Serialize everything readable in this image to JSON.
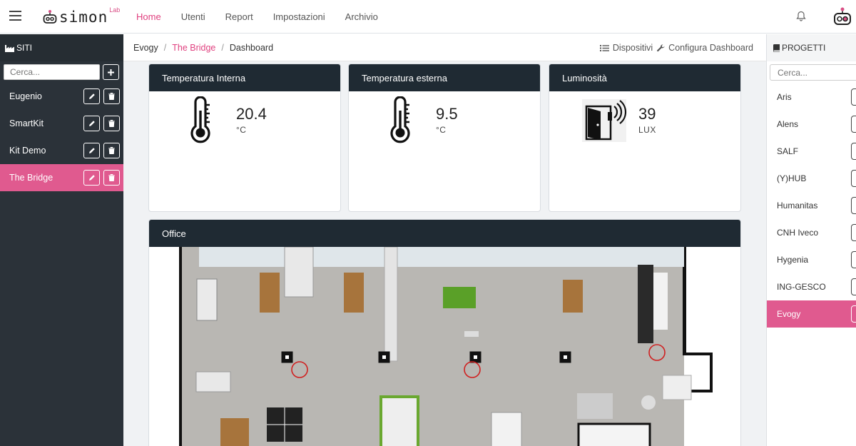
{
  "topbar": {
    "logo_text": "simon",
    "logo_sup": "Lab",
    "nav": [
      {
        "label": "Home",
        "active": true
      },
      {
        "label": "Utenti",
        "active": false
      },
      {
        "label": "Report",
        "active": false
      },
      {
        "label": "Impostazioni",
        "active": false
      },
      {
        "label": "Archivio",
        "active": false
      }
    ]
  },
  "sidebar": {
    "title": "SITI",
    "search_placeholder": "Cerca...",
    "sites": [
      {
        "label": "Eugenio",
        "active": false
      },
      {
        "label": "SmartKit",
        "active": false
      },
      {
        "label": "Kit Demo",
        "active": false
      },
      {
        "label": "The Bridge",
        "active": true
      }
    ]
  },
  "breadcrumb": {
    "items": [
      "Evogy",
      "The Bridge",
      "Dashboard"
    ],
    "actions": [
      "Dispositivi",
      "Configura Dashboard"
    ]
  },
  "cards": [
    {
      "title": "Temperatura Interna",
      "value": "20.4",
      "unit": "°C",
      "icon": "thermometer-icon"
    },
    {
      "title": "Temperatura esterna",
      "value": "9.5",
      "unit": "°C",
      "icon": "thermometer-icon"
    },
    {
      "title": "Luminosità",
      "value": "39",
      "unit": "LUX",
      "icon": "door-sensor-icon"
    }
  ],
  "office": {
    "title": "Office"
  },
  "projects": {
    "title": "PROGETTI",
    "search_placeholder": "Cerca...",
    "items": [
      {
        "label": "Aris",
        "active": false
      },
      {
        "label": "Alens",
        "active": false
      },
      {
        "label": "SALF",
        "active": false
      },
      {
        "label": "(Y)HUB",
        "active": false
      },
      {
        "label": "Humanitas",
        "active": false
      },
      {
        "label": "CNH Iveco",
        "active": false
      },
      {
        "label": "Hygenia",
        "active": false
      },
      {
        "label": "ING-GESCO",
        "active": false
      },
      {
        "label": "Evogy",
        "active": true
      }
    ]
  },
  "colors": {
    "accent": "#e0407f",
    "sidebar_bg": "#2b3239",
    "card_header": "#1f2a33"
  }
}
